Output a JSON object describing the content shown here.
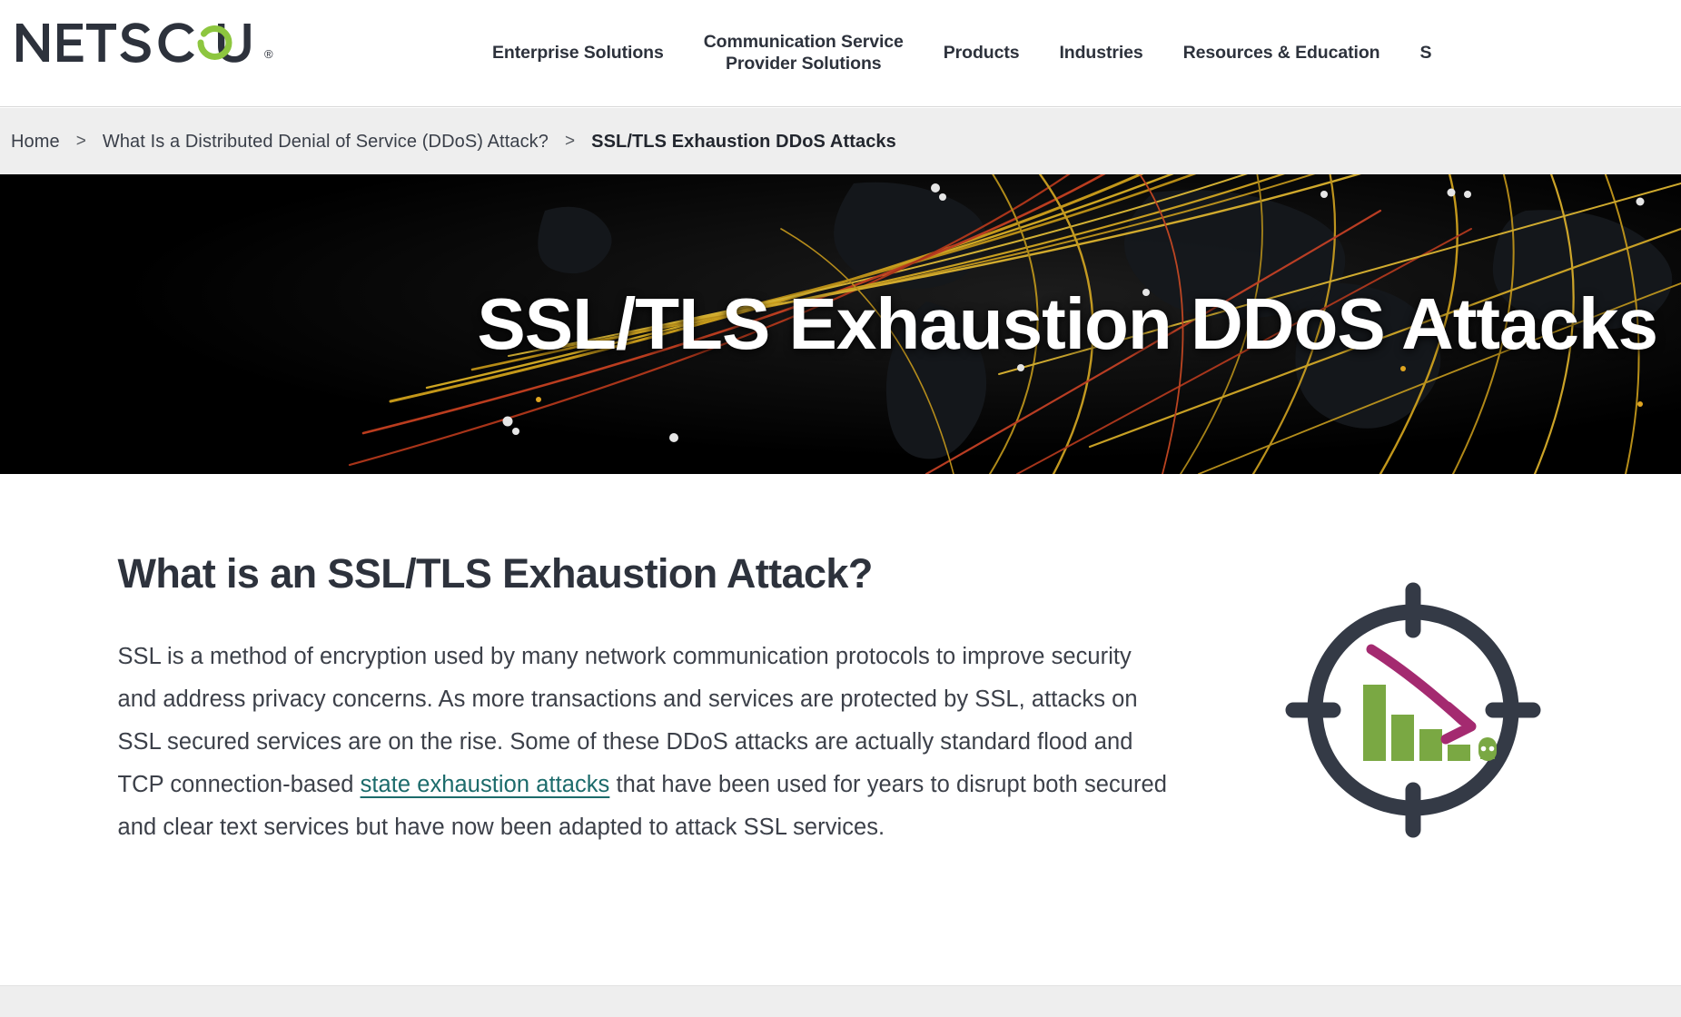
{
  "brand": {
    "name": "NETSCOUT",
    "registered_mark": "®",
    "logo_dark_color": "#2d323c",
    "logo_accent_color": "#8dc63f"
  },
  "header": {
    "nav_items": [
      {
        "label": "Enterprise Solutions",
        "clipped": false
      },
      {
        "label": "Communication Service\nProvider Solutions",
        "clipped": false
      },
      {
        "label": "Products",
        "clipped": false
      },
      {
        "label": "Industries",
        "clipped": false
      },
      {
        "label": "Resources & Education",
        "clipped": false
      },
      {
        "label": "S",
        "clipped": true
      }
    ]
  },
  "breadcrumb": {
    "separator": ">",
    "items": [
      {
        "label": "Home",
        "current": false
      },
      {
        "label": "What Is a Distributed Denial of Service (DDoS) Attack?",
        "current": false
      },
      {
        "label": "SSL/TLS Exhaustion DDoS Attacks",
        "current": true
      }
    ]
  },
  "hero": {
    "title": "SSL/TLS Exhaustion DDoS Attacks",
    "background_description": "dark world map with global attack trajectory lines",
    "background_color": "#000000",
    "line_colors": [
      "#e8b92a",
      "#d4a017",
      "#cc3b20",
      "#f0c040"
    ]
  },
  "main": {
    "heading": "What is an SSL/TLS Exhaustion Attack?",
    "paragraph_part1": "SSL is a method of encryption used by many network communication protocols to improve security and address privacy concerns. As more transactions and services are protected by SSL, attacks on SSL secured services are on the rise. Some of these DDoS attacks are actually standard flood and TCP connection-based ",
    "link_text": "state exhaustion attacks",
    "paragraph_part2": " that have been used for years to disrupt both secured and clear text services but have now been adapted to attack SSL services.",
    "link_color": "#1c6b6b"
  },
  "illustration": {
    "name": "crosshair-declining-bar-chart-skull",
    "crosshair_color": "#343a46",
    "bar_color": "#7aa843",
    "arrow_color": "#a42a70",
    "skull_color": "#7aa843",
    "bar_values": [
      100,
      62,
      44,
      24
    ]
  }
}
